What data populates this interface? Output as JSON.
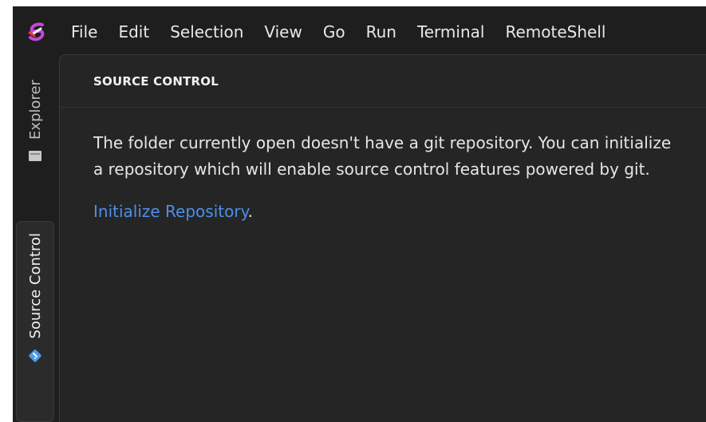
{
  "menubar": {
    "items": [
      "File",
      "Edit",
      "Selection",
      "View",
      "Go",
      "Run",
      "Terminal",
      "RemoteShell"
    ]
  },
  "activity": {
    "tabs": [
      {
        "label": "Explorer",
        "icon": "folder-icon",
        "active": false
      },
      {
        "label": "Source Control",
        "icon": "source-control-icon",
        "active": true
      }
    ]
  },
  "panel": {
    "title": "SOURCE CONTROL",
    "message": "The folder currently open doesn't have a git repository. You can initialize a repository which will enable source control features powered by git.",
    "link_text": "Initialize Repository",
    "link_suffix": "."
  },
  "colors": {
    "background": "#1e1e1f",
    "panel": "#252526",
    "link": "#4d8fe8"
  }
}
